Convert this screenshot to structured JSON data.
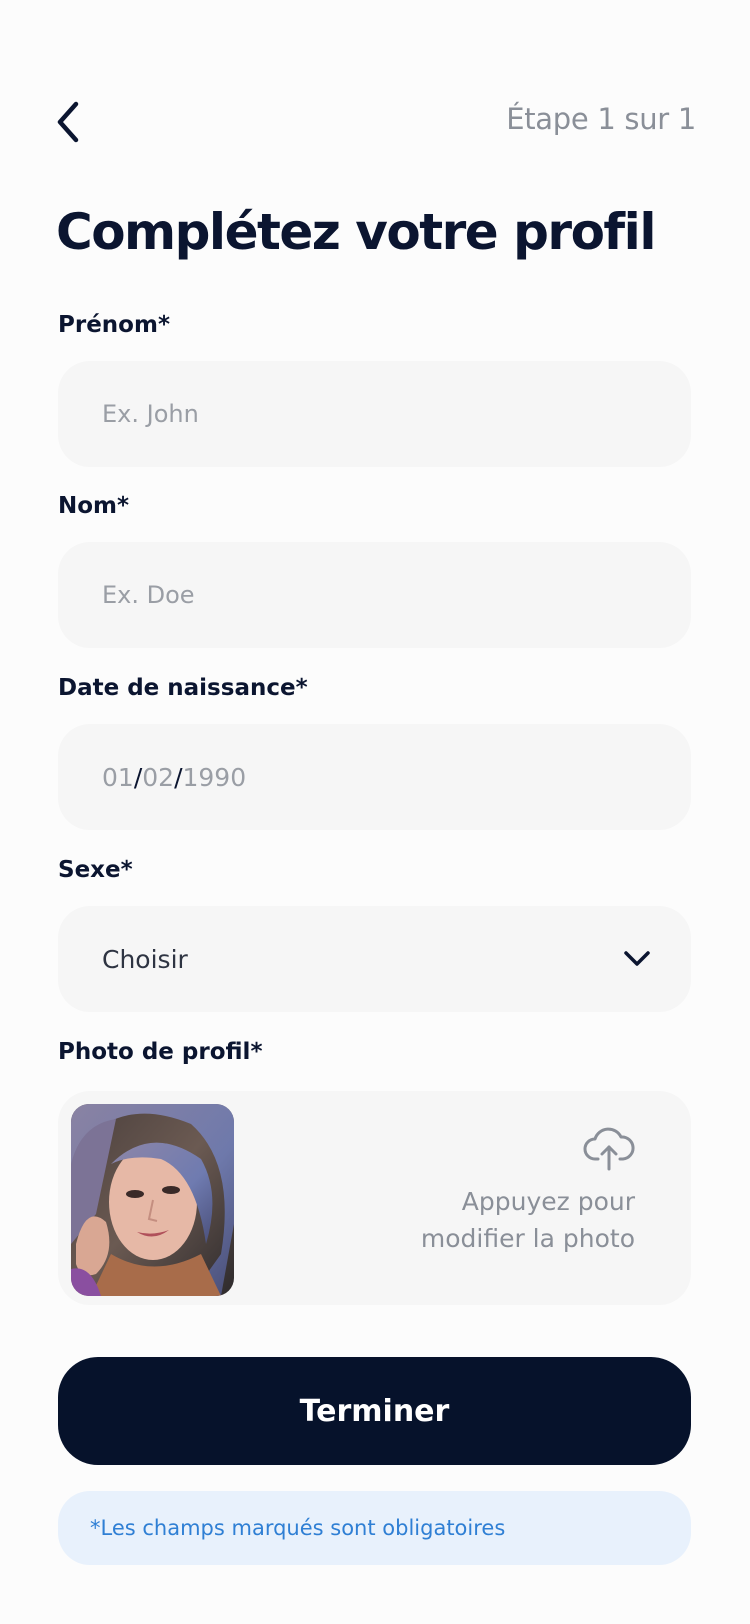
{
  "header": {
    "step_text": "Étape 1 sur 1"
  },
  "title": "Complétez votre profil",
  "fields": {
    "first_name": {
      "label": "Prénom*",
      "placeholder": "Ex. John",
      "value": ""
    },
    "last_name": {
      "label": "Nom*",
      "placeholder": "Ex. Doe",
      "value": ""
    },
    "birth_date": {
      "label": "Date de naissance*",
      "day": "01",
      "month": "02",
      "year": "1990",
      "separator": "/"
    },
    "sex": {
      "label": "Sexe*",
      "selected": "Choisir"
    },
    "photo": {
      "label": "Photo de profil*",
      "hint": "Appuyez pour modifier la photo"
    }
  },
  "submit_label": "Terminer",
  "required_note": "*Les champs marqués sont obligatoires",
  "icons": {
    "back": "chevron-left-icon",
    "select": "chevron-down-icon",
    "upload": "cloud-upload-icon"
  },
  "colors": {
    "primary": "#06122b",
    "field_bg": "#f6f6f6",
    "note_bg": "#e8f1fc",
    "note_text": "#2f7fd4",
    "muted": "#8a8f98"
  }
}
